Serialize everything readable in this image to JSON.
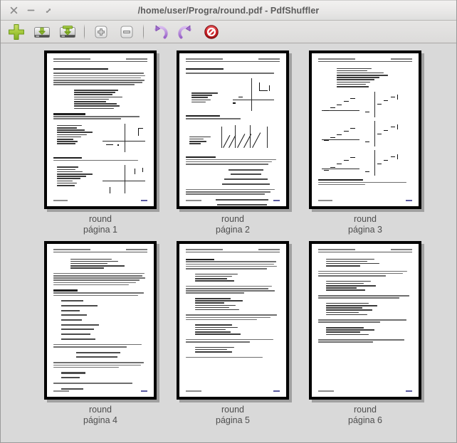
{
  "window": {
    "title": "/home/user/Progra/round.pdf - PdfShuffler",
    "controls": [
      {
        "name": "close",
        "glyph": "×"
      },
      {
        "name": "minimize",
        "glyph": "−"
      },
      {
        "name": "maximize",
        "glyph": "↗"
      }
    ]
  },
  "toolbar": {
    "items": [
      {
        "id": "add",
        "label": "Add",
        "icon": "plus-icon"
      },
      {
        "id": "save",
        "label": "Save",
        "icon": "save-icon"
      },
      {
        "id": "save-as",
        "label": "Save As",
        "icon": "save-as-icon"
      },
      {
        "id": "sep1",
        "label": "",
        "icon": "separator"
      },
      {
        "id": "zoom-in",
        "label": "Zoom In",
        "icon": "zoom-in-icon"
      },
      {
        "id": "zoom-out",
        "label": "Zoom Out",
        "icon": "zoom-out-icon"
      },
      {
        "id": "sep2",
        "label": "",
        "icon": "separator"
      },
      {
        "id": "rotate-left",
        "label": "Rotate Left",
        "icon": "rotate-left-icon"
      },
      {
        "id": "rotate-right",
        "label": "Rotate Right",
        "icon": "rotate-right-icon"
      },
      {
        "id": "delete",
        "label": "Delete",
        "icon": "delete-icon"
      }
    ]
  },
  "pages": [
    {
      "index": 1,
      "document_name": "round",
      "page_label": "página 1",
      "caption": "round\npágina 1"
    },
    {
      "index": 2,
      "document_name": "round",
      "page_label": "página 2",
      "caption": "round\npágina 2"
    },
    {
      "index": 3,
      "document_name": "round",
      "page_label": "página 3",
      "caption": "round\npágina 3"
    },
    {
      "index": 4,
      "document_name": "round",
      "page_label": "página 4",
      "caption": "round\npágina 4"
    },
    {
      "index": 5,
      "document_name": "round",
      "page_label": "página 5",
      "caption": "round\npágina 5"
    },
    {
      "index": 6,
      "document_name": "round",
      "page_label": "página 6",
      "caption": "round\npágina 6"
    }
  ],
  "colors": {
    "window_background": "#d6d6d6",
    "page_area_background": "#d9d9d9",
    "titlebar_background": "#eeeded",
    "toolbar_background": "#e1e0df",
    "title_text": "#5c5c5c",
    "label_text": "#4e4e4e",
    "page_border": "#000000",
    "page_shadow": "#8c8c8c",
    "accent_add": "#8fbf3f",
    "accent_rotate": "#a77fd0",
    "accent_delete": "#c9252a"
  }
}
